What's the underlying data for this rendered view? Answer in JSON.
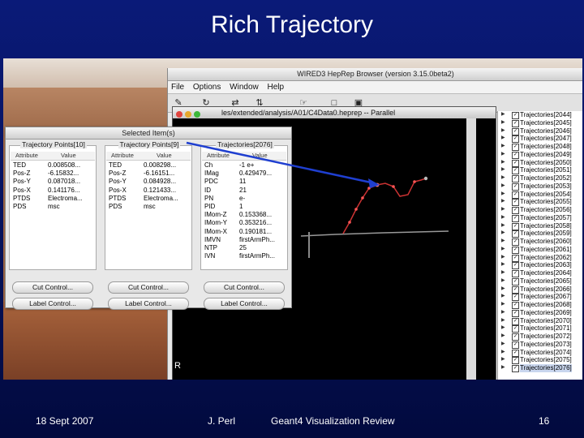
{
  "slide": {
    "title": "Rich Trajectory",
    "footer": {
      "date": "18 Sept 2007",
      "author": "J. Perl",
      "event": "Geant4 Visualization Review",
      "page": "16"
    }
  },
  "wired": {
    "title": "WIRED3 HepRep Browser (version 3.15.0beta2)",
    "menu": [
      "File",
      "Options",
      "Window",
      "Help"
    ],
    "toolbar_icons": [
      "cursor-icon",
      "rotate-icon",
      "translate-icon",
      "fit-icon",
      "hand-icon",
      "page-icon",
      "window-icon"
    ],
    "parallel_title": "les/extended/analysis/A01/C4Data0.heprep -- Parallel",
    "scale_label": "R"
  },
  "tree": {
    "items": [
      "Trajectories[2044]",
      "Trajectories[2045]",
      "Trajectories[2046]",
      "Trajectories[2047]",
      "Trajectories[2048]",
      "Trajectories[2049]",
      "Trajectories[2050]",
      "Trajectories[2051]",
      "Trajectories[2052]",
      "Trajectories[2053]",
      "Trajectories[2054]",
      "Trajectories[2055]",
      "Trajectories[2056]",
      "Trajectories[2057]",
      "Trajectories[2058]",
      "Trajectories[2059]",
      "Trajectories[2060]",
      "Trajectories[2061]",
      "Trajectories[2062]",
      "Trajectories[2063]",
      "Trajectories[2064]",
      "Trajectories[2065]",
      "Trajectories[2066]",
      "Trajectories[2067]",
      "Trajectories[2068]",
      "Trajectories[2069]",
      "Trajectories[2070]",
      "Trajectories[2071]",
      "Trajectories[2072]",
      "Trajectories[2073]",
      "Trajectories[2074]",
      "Trajectories[2075]",
      "Trajectories[2076]"
    ],
    "selected_item": "Trajectories[2076]"
  },
  "dialog": {
    "title": "Selected Item(s)",
    "col_attribute": "Attribute",
    "col_value": "Value",
    "cut_control": "Cut Control...",
    "label_control": "Label Control...",
    "panes": [
      {
        "title": "Trajectory Points[10]",
        "rows": [
          [
            "TED",
            "0.008508..."
          ],
          [
            "Pos-Z",
            "-6.15832..."
          ],
          [
            "Pos-Y",
            "0.087018..."
          ],
          [
            "Pos-X",
            "0.141176..."
          ],
          [
            "PTDS",
            "Electroma..."
          ],
          [
            "PDS",
            "msc"
          ]
        ]
      },
      {
        "title": "Trajectory Points[9]",
        "rows": [
          [
            "TED",
            "0.008298..."
          ],
          [
            "Pos-Z",
            "-6.16151..."
          ],
          [
            "Pos-Y",
            "0.084928..."
          ],
          [
            "Pos-X",
            "0.121433..."
          ],
          [
            "PTDS",
            "Electroma..."
          ],
          [
            "PDS",
            "msc"
          ]
        ]
      },
      {
        "title": "Trajectories[2076]",
        "rows": [
          [
            "Ch",
            "-1 e+"
          ],
          [
            "IMag",
            "0.429479..."
          ],
          [
            "PDC",
            "11"
          ],
          [
            "ID",
            "21"
          ],
          [
            "PN",
            "e-"
          ],
          [
            "PID",
            "1"
          ],
          [
            "IMom-Z",
            "0.153368..."
          ],
          [
            "IMom-Y",
            "0.353216..."
          ],
          [
            "IMom-X",
            "0.190181..."
          ],
          [
            "IMVN",
            "firstArmPh..."
          ],
          [
            "NTP",
            "25"
          ],
          [
            "IVN",
            "firstArmPh..."
          ]
        ]
      }
    ]
  },
  "colors": {
    "background": "#0a1a78",
    "track": "#cc3333",
    "arrow": "#1f3fd0"
  }
}
